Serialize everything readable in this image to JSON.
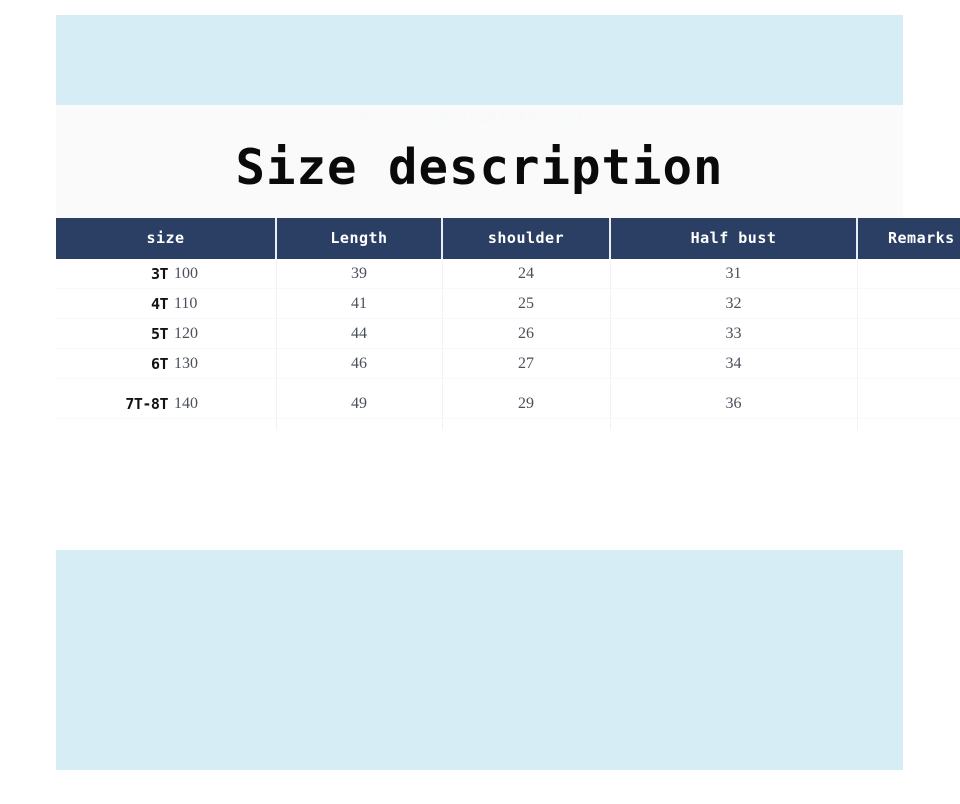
{
  "page": {
    "background_color": "#ffffff",
    "panel_color": "#d6edf6",
    "title_band_color": "#fafafa",
    "header_color": "#2a3f63"
  },
  "title": "Size description",
  "ghost_line": "MOST SIZE CHART PROVIDED",
  "table": {
    "headers": [
      {
        "key": "size",
        "label": "size"
      },
      {
        "key": "length",
        "label": "Length"
      },
      {
        "key": "shoulder",
        "label": "shoulder"
      },
      {
        "key": "halfbust",
        "label": "Half bust"
      },
      {
        "key": "remarks",
        "label": "Remarks"
      }
    ],
    "rows": [
      {
        "size": "3T",
        "length": "100",
        "shoulder": "39",
        "halfbust": "24",
        "bust2": "31",
        "remarks": ""
      },
      {
        "size": "4T",
        "length": "110",
        "shoulder": "41",
        "halfbust": "25",
        "bust2": "32",
        "remarks": ""
      },
      {
        "size": "5T",
        "length": "120",
        "shoulder": "44",
        "halfbust": "26",
        "bust2": "33",
        "remarks": ""
      },
      {
        "size": "6T",
        "length": "130",
        "shoulder": "46",
        "halfbust": "27",
        "bust2": "34",
        "remarks": ""
      },
      {
        "size": "7T-8T",
        "length": "140",
        "shoulder": "49",
        "halfbust": "29",
        "bust2": "36",
        "remarks": ""
      }
    ]
  },
  "chart_data": {
    "type": "table",
    "title": "Size description",
    "categories": [
      "3T",
      "4T",
      "5T",
      "6T",
      "7T-8T"
    ],
    "series": [
      {
        "name": "Length",
        "values": [
          100,
          110,
          120,
          130,
          140
        ]
      },
      {
        "name": "shoulder",
        "values": [
          39,
          41,
          44,
          46,
          49
        ]
      },
      {
        "name": "Half bust",
        "values": [
          24,
          25,
          26,
          27,
          29
        ]
      },
      {
        "name": "Remarks",
        "values": [
          31,
          32,
          33,
          34,
          36
        ]
      }
    ],
    "xlabel": "size",
    "ylabel": "",
    "grid": false,
    "legend": "none"
  }
}
